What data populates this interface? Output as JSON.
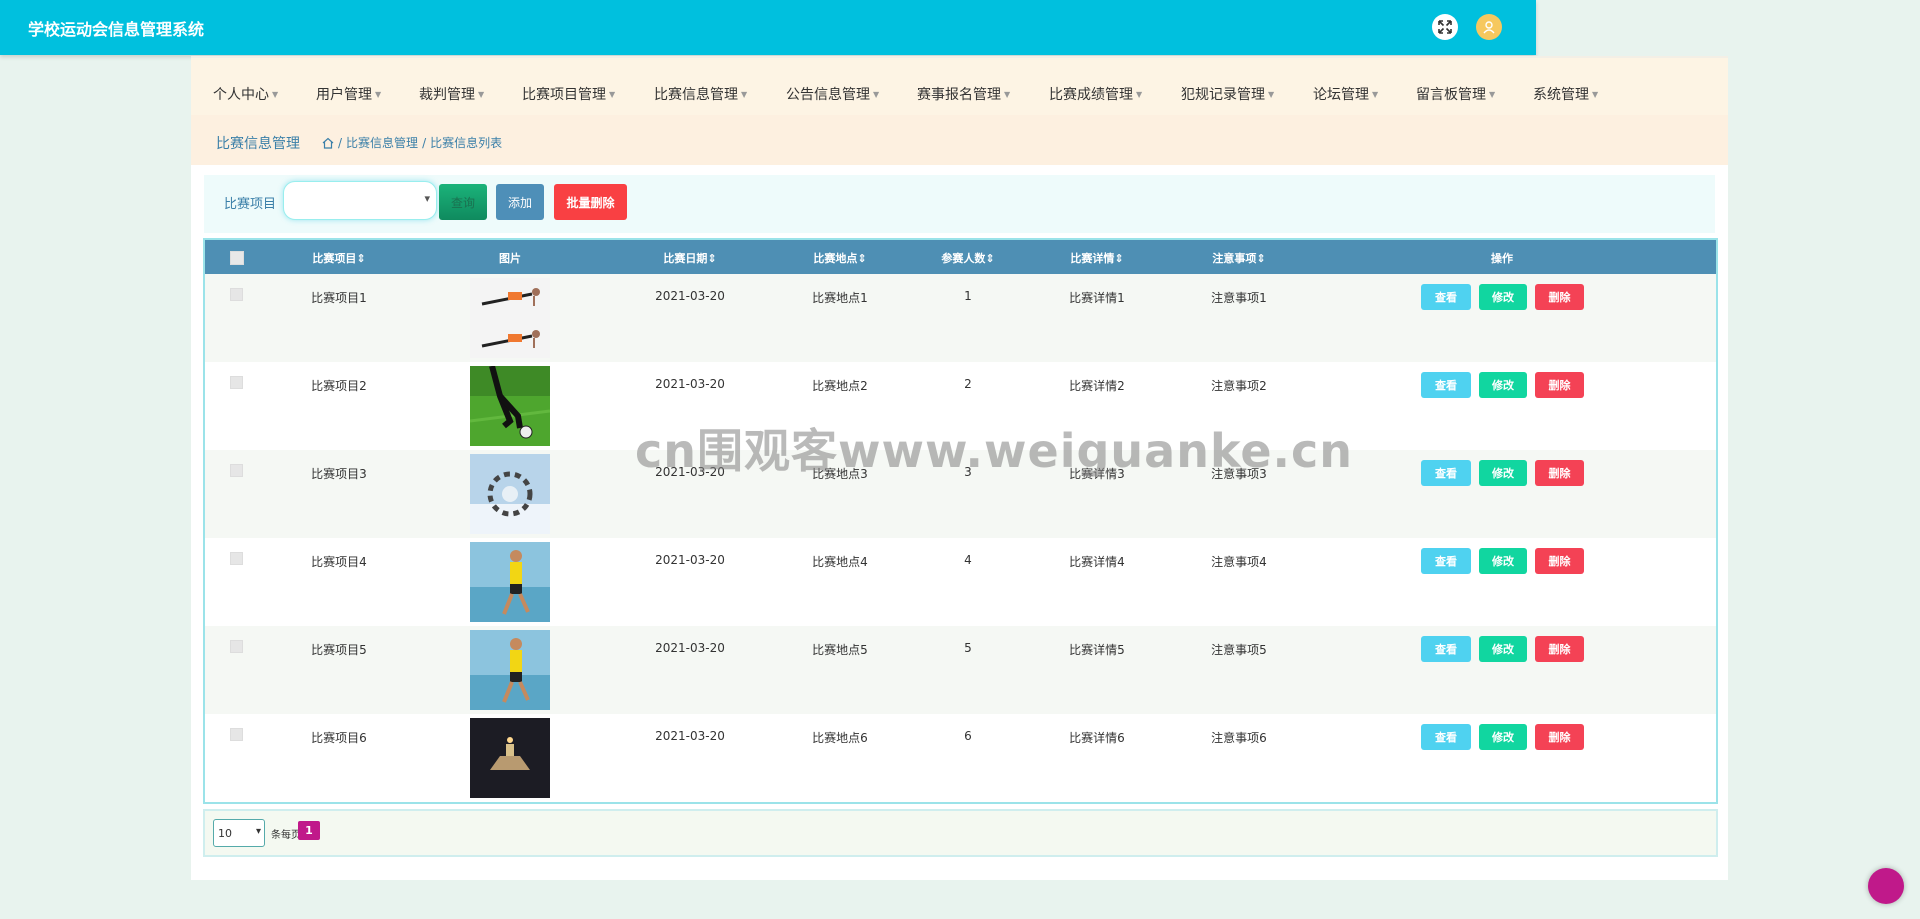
{
  "header": {
    "app_title": "学校运动会信息管理系统",
    "fullscreen_icon": "fullscreen-icon",
    "user_icon": "user-avatar-icon"
  },
  "nav": {
    "items": [
      {
        "label": "个人中心"
      },
      {
        "label": "用户管理"
      },
      {
        "label": "裁判管理"
      },
      {
        "label": "比赛项目管理"
      },
      {
        "label": "比赛信息管理"
      },
      {
        "label": "公告信息管理"
      },
      {
        "label": "赛事报名管理"
      },
      {
        "label": "比赛成绩管理"
      },
      {
        "label": "犯规记录管理"
      },
      {
        "label": "论坛管理"
      },
      {
        "label": "留言板管理"
      },
      {
        "label": "系统管理"
      }
    ]
  },
  "breadcrumb": {
    "title": "比赛信息管理",
    "sep": "/",
    "level1": "比赛信息管理",
    "level2": "比赛信息列表"
  },
  "search": {
    "label": "比赛项目",
    "selected": "",
    "query_label": "查询",
    "add_label": "添加",
    "batch_delete_label": "批量删除"
  },
  "table": {
    "headers": {
      "project": "比赛项目",
      "image": "图片",
      "date": "比赛日期",
      "location": "比赛地点",
      "participants": "参赛人数",
      "details": "比赛详情",
      "notes": "注意事项",
      "actions": "操作"
    },
    "rows": [
      {
        "project": "比赛项目1",
        "date": "2021-03-20",
        "location": "比赛地点1",
        "participants": "1",
        "details": "比赛详情1",
        "notes": "注意事项1"
      },
      {
        "project": "比赛项目2",
        "date": "2021-03-20",
        "location": "比赛地点2",
        "participants": "2",
        "details": "比赛详情2",
        "notes": "注意事项2"
      },
      {
        "project": "比赛项目3",
        "date": "2021-03-20",
        "location": "比赛地点3",
        "participants": "3",
        "details": "比赛详情3",
        "notes": "注意事项3"
      },
      {
        "project": "比赛项目4",
        "date": "2021-03-20",
        "location": "比赛地点4",
        "participants": "4",
        "details": "比赛详情4",
        "notes": "注意事项4"
      },
      {
        "project": "比赛项目5",
        "date": "2021-03-20",
        "location": "比赛地点5",
        "participants": "5",
        "details": "比赛详情5",
        "notes": "注意事项5"
      },
      {
        "project": "比赛项目6",
        "date": "2021-03-20",
        "location": "比赛地点6",
        "participants": "6",
        "details": "比赛详情6",
        "notes": "注意事项6"
      }
    ],
    "view_label": "查看",
    "edit_label": "修改",
    "delete_label": "删除"
  },
  "pagination": {
    "page_size": "10",
    "per_page_label": "条每页",
    "current_page": "1"
  },
  "watermark": "cn围观客www.weiguanke.cn",
  "colors": {
    "topbar": "#00c0de",
    "table_header": "#4e8fb4",
    "view": "#4fd2f0",
    "edit": "#11d6a0",
    "delete": "#f44255",
    "page_active": "#c0198a"
  }
}
